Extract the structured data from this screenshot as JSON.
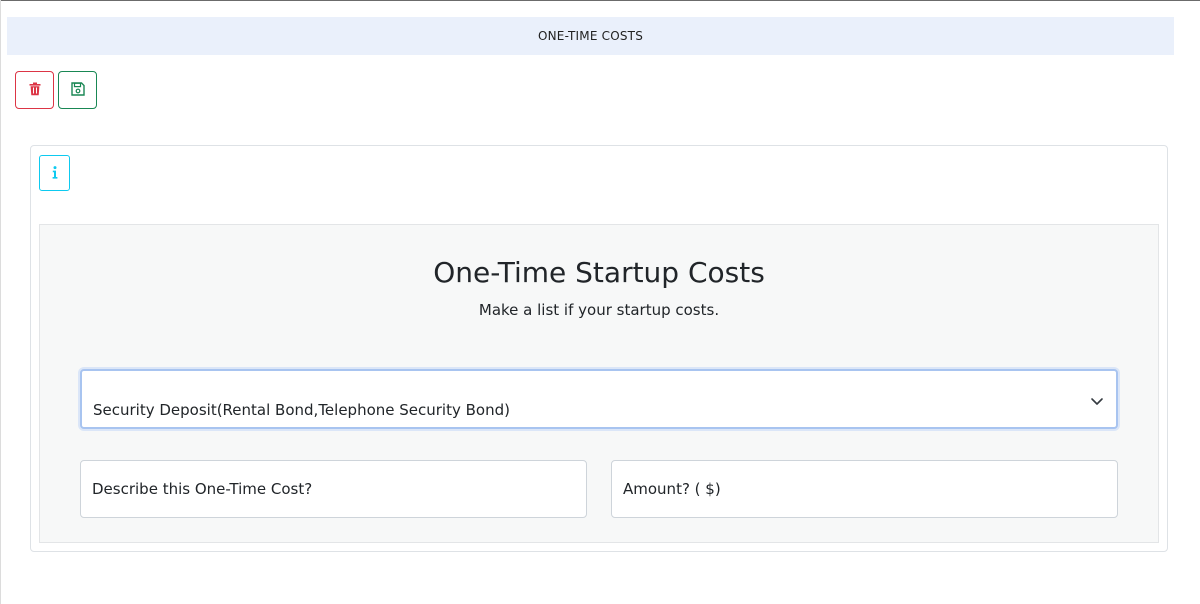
{
  "header": {
    "title": "ONE-TIME COSTS"
  },
  "toolbar": {
    "delete_icon": "trash-icon",
    "save_icon": "floppy-disk-icon",
    "delete_color": "#dc3545",
    "save_color": "#198754"
  },
  "card": {
    "info_icon": "info-icon",
    "info_color": "#0dcaf0",
    "title": "One-Time Startup Costs",
    "subtitle": "Make a list if your startup costs.",
    "select": {
      "value": "Security Deposit(Rental Bond,Telephone Security Bond)"
    },
    "fields": {
      "description_label": "Describe this One-Time Cost?",
      "amount_label": "Amount? ( $)"
    }
  }
}
